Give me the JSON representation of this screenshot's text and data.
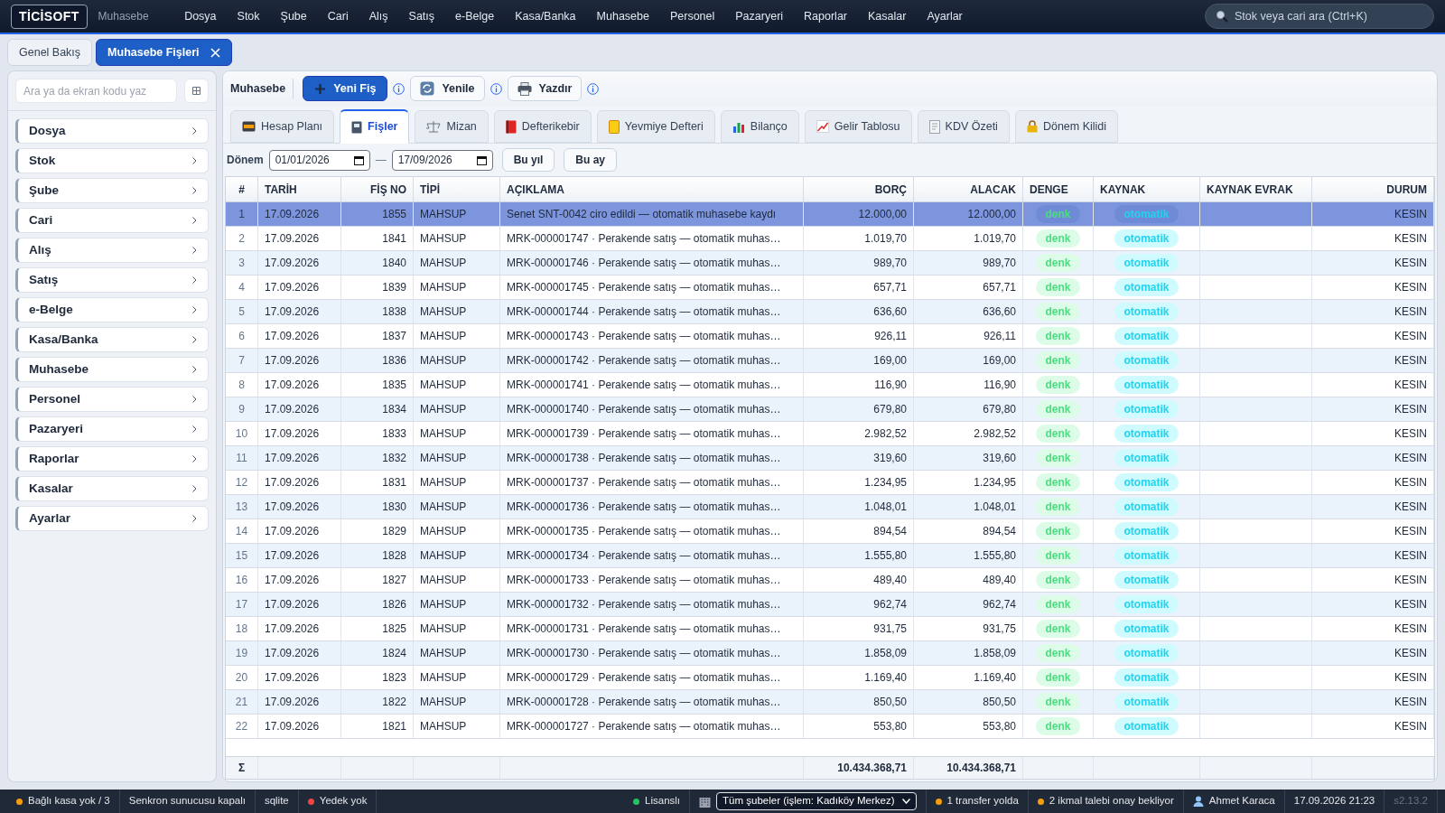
{
  "topbar": {
    "logo": "TİCİSOFT",
    "module": "Muhasebe",
    "menu": [
      "Dosya",
      "Stok",
      "Şube",
      "Cari",
      "Alış",
      "Satış",
      "e-Belge",
      "Kasa/Banka",
      "Muhasebe",
      "Personel",
      "Pazaryeri",
      "Raporlar",
      "Kasalar",
      "Ayarlar"
    ],
    "search": {
      "placeholder": "Stok veya cari ara (Ctrl+K)"
    }
  },
  "page_tabs": [
    {
      "label": "Genel Bakış",
      "selected": false,
      "closable": false
    },
    {
      "label": "Muhasebe Fişleri",
      "selected": true,
      "closable": true
    }
  ],
  "sidebar": {
    "search": {
      "placeholder": "Ara ya da ekran kodu yaz"
    },
    "items": [
      "Dosya",
      "Stok",
      "Şube",
      "Cari",
      "Alış",
      "Satış",
      "e-Belge",
      "Kasa/Banka",
      "Muhasebe",
      "Personel",
      "Pazaryeri",
      "Raporlar",
      "Kasalar",
      "Ayarlar"
    ]
  },
  "toolbar": {
    "title": "Muhasebe",
    "buttons": [
      {
        "label": "Yeni Fiş",
        "kind": "primary"
      },
      {
        "label": "Yenile",
        "kind": "refresh"
      },
      {
        "label": "Yazdır",
        "kind": "print"
      }
    ]
  },
  "module_tabs": [
    {
      "label": "Hesap Planı",
      "selected": false
    },
    {
      "label": "Fişler",
      "selected": true
    },
    {
      "label": "Mizan",
      "selected": false
    },
    {
      "label": "Defterikebir",
      "selected": false
    },
    {
      "label": "Yevmiye Defteri",
      "selected": false
    },
    {
      "label": "Bilanço",
      "selected": false
    },
    {
      "label": "Gelir Tablosu",
      "selected": false
    },
    {
      "label": "KDV Özeti",
      "selected": false
    },
    {
      "label": "Dönem Kilidi",
      "selected": false
    }
  ],
  "filter": {
    "label": "Dönem",
    "start": "01/01/2026",
    "separator": "—",
    "end": "17/09/2026",
    "buttons": [
      "Bu yıl",
      "Bu ay"
    ]
  },
  "table": {
    "columns": [
      "#",
      "TARİH",
      "FİŞ NO",
      "TİPİ",
      "AÇIKLAMA",
      "BORÇ",
      "ALACAK",
      "DENGE",
      "KAYNAK",
      "KAYNAK EVRAK",
      "DURUM"
    ],
    "rows": [
      {
        "selected": true,
        "no": "1",
        "date": "17.09.2026",
        "fis_no": "1855",
        "type": "MAHSUP",
        "description": "Senet SNT-0042 ciro edildi — otomatik muhasebe kaydı",
        "borc": "12.000,00",
        "alacak": "12.000,00",
        "denge": "denk",
        "kaynak": "otomatik",
        "durum": "KESIN"
      },
      {
        "selected": false,
        "no": "2",
        "date": "17.09.2026",
        "fis_no": "1841",
        "type": "MAHSUP",
        "description": "MRK-000001747 · Perakende satış — otomatik muhas…",
        "borc": "1.019,70",
        "alacak": "1.019,70",
        "denge": "denk",
        "kaynak": "otomatik",
        "durum": "KESIN"
      },
      {
        "selected": false,
        "no": "3",
        "date": "17.09.2026",
        "fis_no": "1840",
        "type": "MAHSUP",
        "description": "MRK-000001746 · Perakende satış — otomatik muhas…",
        "borc": "989,70",
        "alacak": "989,70",
        "denge": "denk",
        "kaynak": "otomatik",
        "durum": "KESIN"
      },
      {
        "selected": false,
        "no": "4",
        "date": "17.09.2026",
        "fis_no": "1839",
        "type": "MAHSUP",
        "description": "MRK-000001745 · Perakende satış — otomatik muhas…",
        "borc": "657,71",
        "alacak": "657,71",
        "denge": "denk",
        "kaynak": "otomatik",
        "durum": "KESIN"
      },
      {
        "selected": false,
        "no": "5",
        "date": "17.09.2026",
        "fis_no": "1838",
        "type": "MAHSUP",
        "description": "MRK-000001744 · Perakende satış — otomatik muhas…",
        "borc": "636,60",
        "alacak": "636,60",
        "denge": "denk",
        "kaynak": "otomatik",
        "durum": "KESIN"
      },
      {
        "selected": false,
        "no": "6",
        "date": "17.09.2026",
        "fis_no": "1837",
        "type": "MAHSUP",
        "description": "MRK-000001743 · Perakende satış — otomatik muhas…",
        "borc": "926,11",
        "alacak": "926,11",
        "denge": "denk",
        "kaynak": "otomatik",
        "durum": "KESIN"
      },
      {
        "selected": false,
        "no": "7",
        "date": "17.09.2026",
        "fis_no": "1836",
        "type": "MAHSUP",
        "description": "MRK-000001742 · Perakende satış — otomatik muhas…",
        "borc": "169,00",
        "alacak": "169,00",
        "denge": "denk",
        "kaynak": "otomatik",
        "durum": "KESIN"
      },
      {
        "selected": false,
        "no": "8",
        "date": "17.09.2026",
        "fis_no": "1835",
        "type": "MAHSUP",
        "description": "MRK-000001741 · Perakende satış — otomatik muhas…",
        "borc": "116,90",
        "alacak": "116,90",
        "denge": "denk",
        "kaynak": "otomatik",
        "durum": "KESIN"
      },
      {
        "selected": false,
        "no": "9",
        "date": "17.09.2026",
        "fis_no": "1834",
        "type": "MAHSUP",
        "description": "MRK-000001740 · Perakende satış — otomatik muhas…",
        "borc": "679,80",
        "alacak": "679,80",
        "denge": "denk",
        "kaynak": "otomatik",
        "durum": "KESIN"
      },
      {
        "selected": false,
        "no": "10",
        "date": "17.09.2026",
        "fis_no": "1833",
        "type": "MAHSUP",
        "description": "MRK-000001739 · Perakende satış — otomatik muhas…",
        "borc": "2.982,52",
        "alacak": "2.982,52",
        "denge": "denk",
        "kaynak": "otomatik",
        "durum": "KESIN"
      },
      {
        "selected": false,
        "no": "11",
        "date": "17.09.2026",
        "fis_no": "1832",
        "type": "MAHSUP",
        "description": "MRK-000001738 · Perakende satış — otomatik muhas…",
        "borc": "319,60",
        "alacak": "319,60",
        "denge": "denk",
        "kaynak": "otomatik",
        "durum": "KESIN"
      },
      {
        "selected": false,
        "no": "12",
        "date": "17.09.2026",
        "fis_no": "1831",
        "type": "MAHSUP",
        "description": "MRK-000001737 · Perakende satış — otomatik muhas…",
        "borc": "1.234,95",
        "alacak": "1.234,95",
        "denge": "denk",
        "kaynak": "otomatik",
        "durum": "KESIN"
      },
      {
        "selected": false,
        "no": "13",
        "date": "17.09.2026",
        "fis_no": "1830",
        "type": "MAHSUP",
        "description": "MRK-000001736 · Perakende satış — otomatik muhas…",
        "borc": "1.048,01",
        "alacak": "1.048,01",
        "denge": "denk",
        "kaynak": "otomatik",
        "durum": "KESIN"
      },
      {
        "selected": false,
        "no": "14",
        "date": "17.09.2026",
        "fis_no": "1829",
        "type": "MAHSUP",
        "description": "MRK-000001735 · Perakende satış — otomatik muhas…",
        "borc": "894,54",
        "alacak": "894,54",
        "denge": "denk",
        "kaynak": "otomatik",
        "durum": "KESIN"
      },
      {
        "selected": false,
        "no": "15",
        "date": "17.09.2026",
        "fis_no": "1828",
        "type": "MAHSUP",
        "description": "MRK-000001734 · Perakende satış — otomatik muhas…",
        "borc": "1.555,80",
        "alacak": "1.555,80",
        "denge": "denk",
        "kaynak": "otomatik",
        "durum": "KESIN"
      },
      {
        "selected": false,
        "no": "16",
        "date": "17.09.2026",
        "fis_no": "1827",
        "type": "MAHSUP",
        "description": "MRK-000001733 · Perakende satış — otomatik muhas…",
        "borc": "489,40",
        "alacak": "489,40",
        "denge": "denk",
        "kaynak": "otomatik",
        "durum": "KESIN"
      },
      {
        "selected": false,
        "no": "17",
        "date": "17.09.2026",
        "fis_no": "1826",
        "type": "MAHSUP",
        "description": "MRK-000001732 · Perakende satış — otomatik muhas…",
        "borc": "962,74",
        "alacak": "962,74",
        "denge": "denk",
        "kaynak": "otomatik",
        "durum": "KESIN"
      },
      {
        "selected": false,
        "no": "18",
        "date": "17.09.2026",
        "fis_no": "1825",
        "type": "MAHSUP",
        "description": "MRK-000001731 · Perakende satış — otomatik muhas…",
        "borc": "931,75",
        "alacak": "931,75",
        "denge": "denk",
        "kaynak": "otomatik",
        "durum": "KESIN"
      },
      {
        "selected": false,
        "no": "19",
        "date": "17.09.2026",
        "fis_no": "1824",
        "type": "MAHSUP",
        "description": "MRK-000001730 · Perakende satış — otomatik muhas…",
        "borc": "1.858,09",
        "alacak": "1.858,09",
        "denge": "denk",
        "kaynak": "otomatik",
        "durum": "KESIN"
      },
      {
        "selected": false,
        "no": "20",
        "date": "17.09.2026",
        "fis_no": "1823",
        "type": "MAHSUP",
        "description": "MRK-000001729 · Perakende satış — otomatik muhas…",
        "borc": "1.169,40",
        "alacak": "1.169,40",
        "denge": "denk",
        "kaynak": "otomatik",
        "durum": "KESIN"
      },
      {
        "selected": false,
        "no": "21",
        "date": "17.09.2026",
        "fis_no": "1822",
        "type": "MAHSUP",
        "description": "MRK-000001728 · Perakende satış — otomatik muhas…",
        "borc": "850,50",
        "alacak": "850,50",
        "denge": "denk",
        "kaynak": "otomatik",
        "durum": "KESIN"
      },
      {
        "selected": false,
        "no": "22",
        "date": "17.09.2026",
        "fis_no": "1821",
        "type": "MAHSUP",
        "description": "MRK-000001727 · Perakende satış — otomatik muhas…",
        "borc": "553,80",
        "alacak": "553,80",
        "denge": "denk",
        "kaynak": "otomatik",
        "durum": "KESIN"
      }
    ],
    "totals": {
      "label": "Σ",
      "borc": "10.434.368,71",
      "alacak": "10.434.368,71"
    }
  },
  "status_bar": {
    "left": [
      {
        "text": "Bağlı kasa yok / 3",
        "color": "#f59e0b"
      },
      {
        "text": "Senkron sunucusu kapalı"
      },
      {
        "text": "sqlite"
      },
      {
        "text": "Yedek yok",
        "color": "#ef4444"
      }
    ],
    "right": [
      {
        "text": "Lisanslı",
        "color": "#22c55e"
      },
      {
        "kind": "branch",
        "text": "Tüm şubeler (işlem: Kadıköy Merkez)"
      },
      {
        "text": "1 transfer yolda",
        "color": "#f59e0b"
      },
      {
        "text": "2 ikmal talebi onay bekliyor",
        "color": "#f59e0b"
      },
      {
        "kind": "user",
        "text": "Ahmet Karaca"
      },
      {
        "text": "17.09.2026 21:23"
      },
      {
        "kind": "version",
        "text": "s2.13.2"
      }
    ]
  }
}
